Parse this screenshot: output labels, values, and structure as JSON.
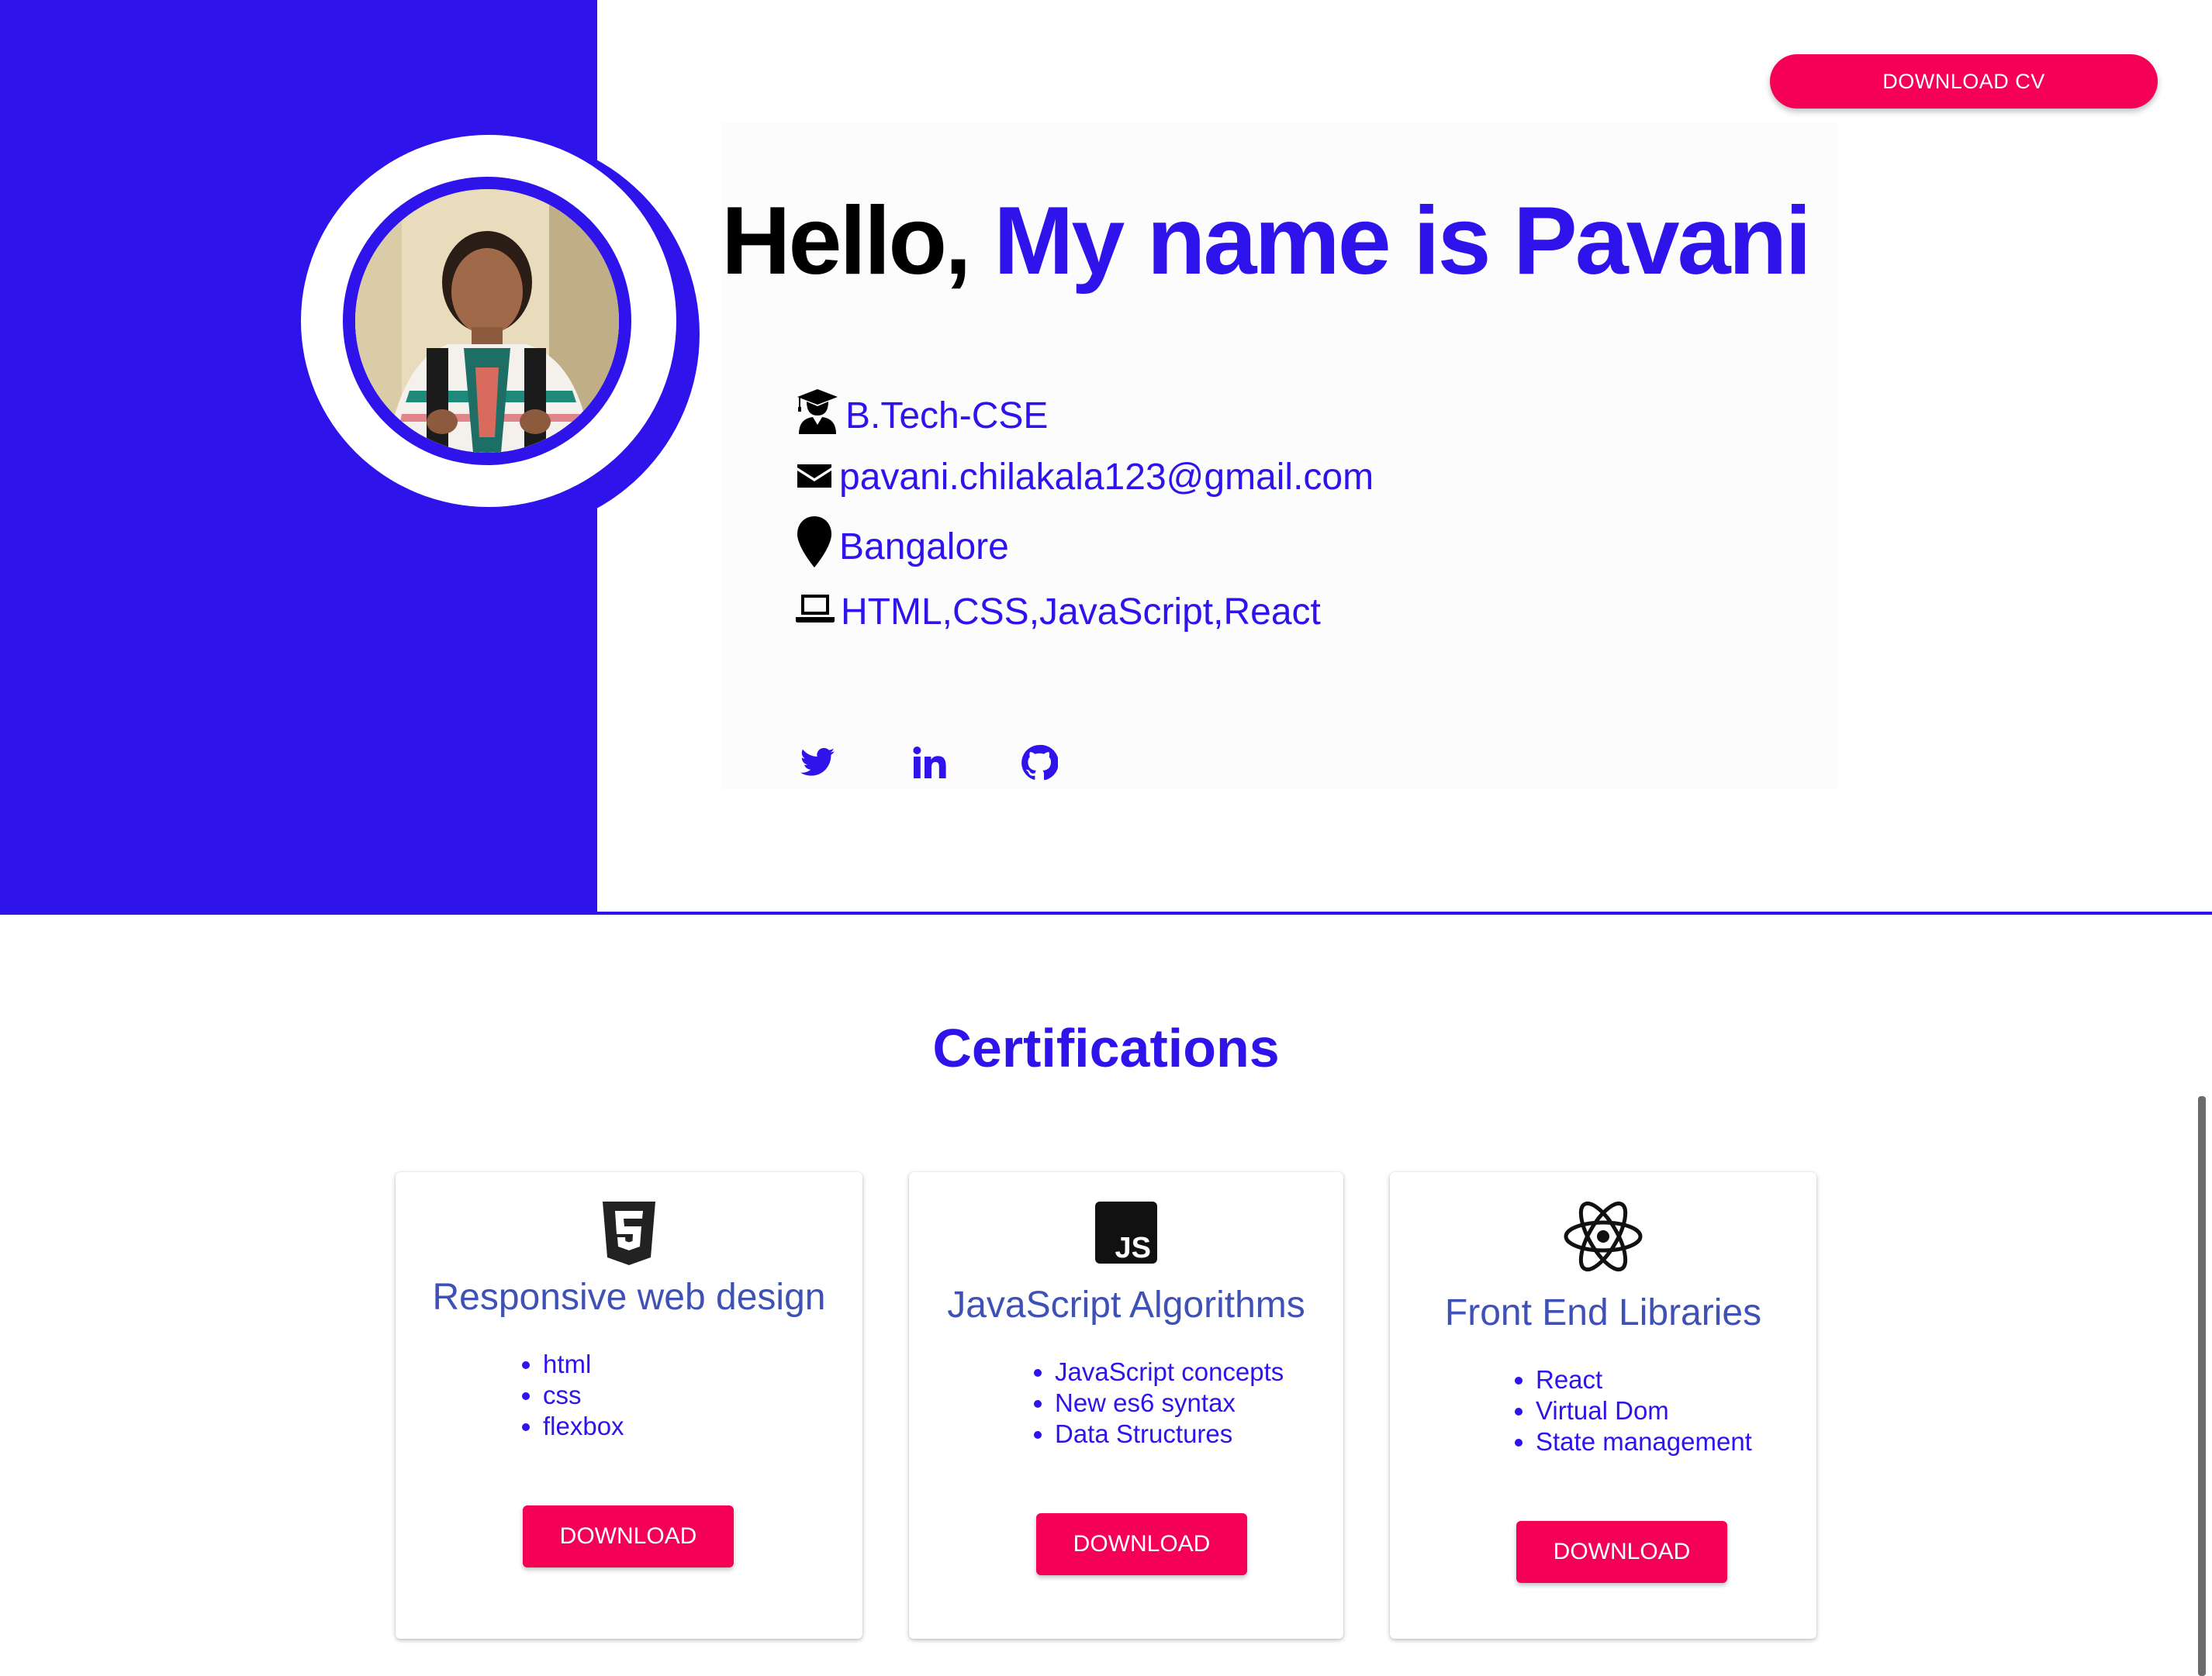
{
  "header": {
    "download_cv_label": "DOWNLOAD CV",
    "hello_prefix": "Hello,",
    "hello_name": "My name is Pavani"
  },
  "profile": {
    "education": "B.Tech-CSE",
    "email": "pavani.chilakala123@gmail.com",
    "location": "Bangalore",
    "skills": "HTML,CSS,JavaScript,React"
  },
  "social": {
    "icons": [
      "twitter-icon",
      "linkedin-icon",
      "github-icon"
    ]
  },
  "certifications": {
    "title": "Certifications",
    "cards": [
      {
        "icon": "html5-icon",
        "name": "Responsive web design",
        "items": [
          "html",
          "css",
          "flexbox"
        ],
        "button": "DOWNLOAD"
      },
      {
        "icon": "javascript-icon",
        "name": "JavaScript Algorithms",
        "items": [
          "JavaScript concepts",
          "New es6 syntax",
          "Data Structures"
        ],
        "button": "DOWNLOAD"
      },
      {
        "icon": "react-icon",
        "name": "Front End Libraries",
        "items": [
          "React",
          "Virtual Dom",
          "State management"
        ],
        "button": "DOWNLOAD"
      }
    ]
  },
  "colors": {
    "primary_blue": "#2e14ea",
    "accent_pink": "#f50057",
    "card_title_blue": "#3f51b5"
  }
}
